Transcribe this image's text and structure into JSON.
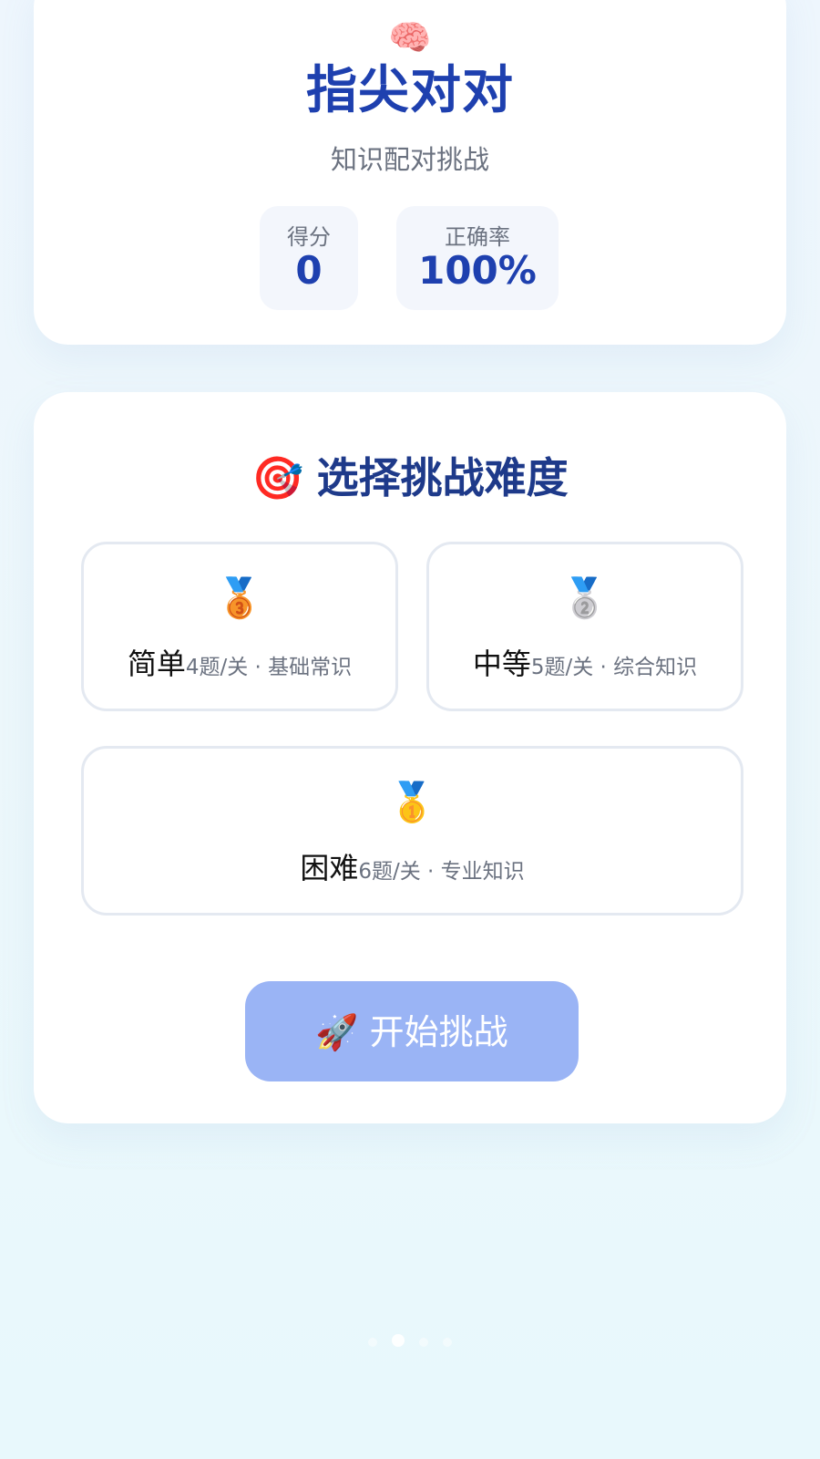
{
  "header": {
    "brain_icon": "🧠",
    "title": "指尖对对",
    "subtitle": "知识配对挑战",
    "stats": {
      "score_label": "得分",
      "score_value": "0",
      "accuracy_label": "正确率",
      "accuracy_value": "100%"
    }
  },
  "difficulty": {
    "target_icon": "🎯",
    "heading": "选择挑战难度",
    "options": [
      {
        "medal": "🥉",
        "name": "简单",
        "desc": "4题/关 · 基础常识"
      },
      {
        "medal": "🥈",
        "name": "中等",
        "desc": "5题/关 · 综合知识"
      },
      {
        "medal": "🥇",
        "name": "困难",
        "desc": "6题/关 · 专业知识"
      }
    ],
    "start_icon": "🚀",
    "start_label": "开始挑战"
  },
  "colors": {
    "primary": "#1e40af",
    "button_disabled": "#9ab4f5",
    "muted_text": "#6b7280",
    "option_border": "#e4e9f1"
  }
}
